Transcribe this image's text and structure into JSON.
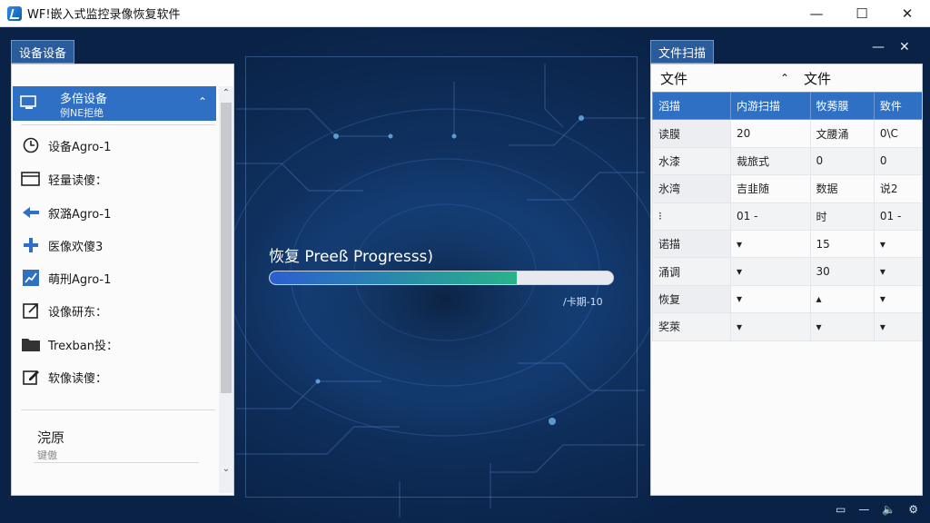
{
  "window": {
    "title": "WF!嵌入式监控录像恢复软件",
    "min_glyph": "—",
    "max_glyph": "☐",
    "close_glyph": "✕"
  },
  "left_panel": {
    "title": "设备设备",
    "selected": {
      "label": "多倍设备",
      "sub": "例NE拒绝",
      "chevron": "⌃"
    },
    "items": [
      {
        "label": "设备Agro-1",
        "icon": "disk-clock-icon"
      },
      {
        "label": "轻量读傻：",
        "icon": "window-icon"
      },
      {
        "label": "叙潞Agro-1",
        "icon": "arrow-left-icon"
      },
      {
        "label": "医像欢傻3",
        "icon": "plus-icon"
      },
      {
        "label": "萌刑Agro-1",
        "icon": "chart-icon"
      },
      {
        "label": "设像研东：",
        "icon": "external-link-icon"
      },
      {
        "label": "Trexban投：",
        "icon": "folder-icon"
      },
      {
        "label": "软像读傻：",
        "icon": "edit-icon"
      }
    ],
    "section": {
      "title": "浣原",
      "sub": "键傲"
    },
    "scroll_up": "⌃",
    "scroll_down": "⌄"
  },
  "progress": {
    "label": "恢复 Preeß Progresss)",
    "value_percent": 72,
    "note": "/卡期-10"
  },
  "right_panel": {
    "title": "文件扫描",
    "controls": {
      "min": "—",
      "close": "✕"
    },
    "headers": {
      "left": "文件",
      "left_chevron": "⌃",
      "right": "文件"
    },
    "columns": [
      "滔描",
      "内游扫描",
      "牧莠膜",
      "致件"
    ],
    "rows": [
      [
        "读膜",
        "20",
        "文腰涌",
        "0\\C"
      ],
      [
        "水漆",
        "裁旅式",
        "0",
        "0"
      ],
      [
        "氷湾",
        "吉韭随",
        "数据",
        "说2"
      ],
      [
        "⁝",
        "01 -",
        "时",
        "01 -"
      ],
      [
        "诺描",
        "▾",
        "15",
        "▾"
      ],
      [
        "涌调",
        "▾",
        "30",
        "▾"
      ],
      [
        "恢复",
        "▾",
        "▴",
        "▾"
      ],
      [
        "奖萊",
        "▾",
        "▾",
        "▾"
      ]
    ]
  },
  "tray": {
    "items": [
      "▭",
      "—",
      "🔈",
      "⚙"
    ]
  }
}
